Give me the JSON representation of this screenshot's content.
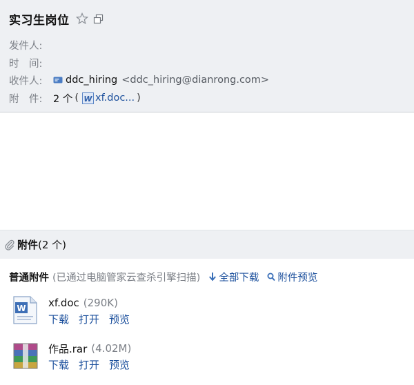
{
  "subject": "实习生岗位",
  "fields": {
    "from_label": "发件人:",
    "time_label": "时　间:",
    "to_label": "收件人:",
    "to_name": "ddc_hiring",
    "to_email": "<ddc_hiring@dianrong.com>",
    "attach_label": "附　件:",
    "attach_count": "2 个",
    "attach_open": "(",
    "attach_preview": "xf.doc...",
    "attach_close": ")"
  },
  "attachments_section": {
    "title": "附件",
    "count": "(2 个)",
    "normal_title": "普通附件",
    "scan_note": "(已通过电脑管家云查杀引擎扫描)",
    "download_all": "全部下载",
    "preview_all": "附件预览",
    "files": [
      {
        "name": "xf.doc",
        "size": "(290K)",
        "type": "word-doc",
        "actions": [
          "下载",
          "打开",
          "预览"
        ]
      },
      {
        "name": "作品.rar",
        "size": "(4.02M)",
        "type": "rar-archive",
        "actions": [
          "下载",
          "打开",
          "预览"
        ]
      }
    ]
  },
  "colors": {
    "header_bg": "#eef0f3",
    "link": "#1b4f9c",
    "muted": "#7b7f86"
  }
}
